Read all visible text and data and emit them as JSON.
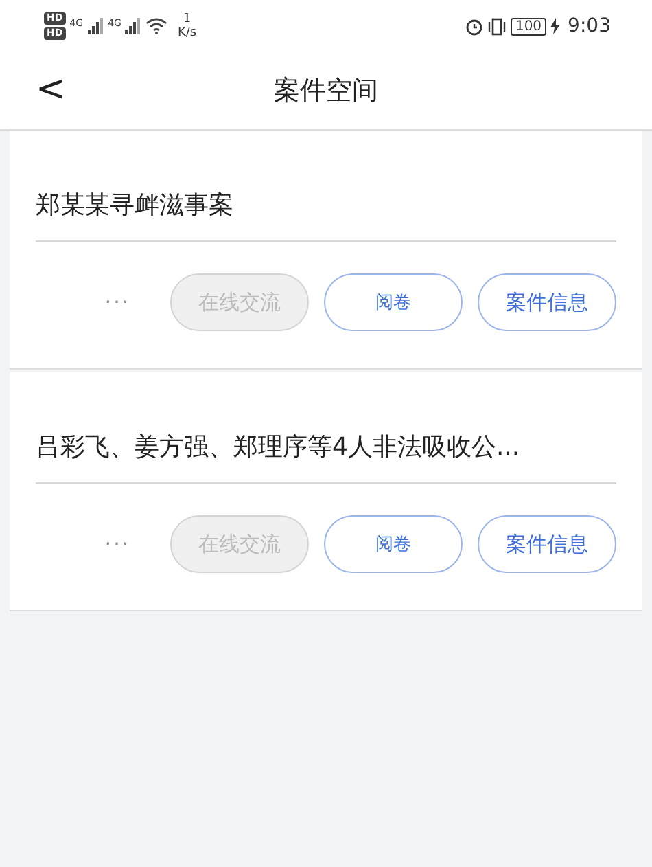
{
  "status_bar": {
    "sim_labels": [
      "HD",
      "HD"
    ],
    "network": [
      "4G",
      "4G"
    ],
    "speed_value": "1",
    "speed_unit": "K/s",
    "battery": "100",
    "time": "9:03"
  },
  "header": {
    "back": "<",
    "title": "案件空间"
  },
  "cases": [
    {
      "title": "郑某某寻衅滋事案",
      "more": "···",
      "buttons": [
        {
          "label": "在线交流",
          "disabled": true,
          "kind": "normal"
        },
        {
          "label": "阅卷",
          "disabled": false,
          "kind": "compact"
        },
        {
          "label": "案件信息",
          "disabled": false,
          "kind": "normal"
        }
      ]
    },
    {
      "title": "吕彩飞、姜方强、郑理序等4人非法吸收公...",
      "more": "···",
      "buttons": [
        {
          "label": "在线交流",
          "disabled": true,
          "kind": "normal"
        },
        {
          "label": "阅卷",
          "disabled": false,
          "kind": "compact"
        },
        {
          "label": "案件信息",
          "disabled": false,
          "kind": "normal"
        }
      ]
    }
  ]
}
